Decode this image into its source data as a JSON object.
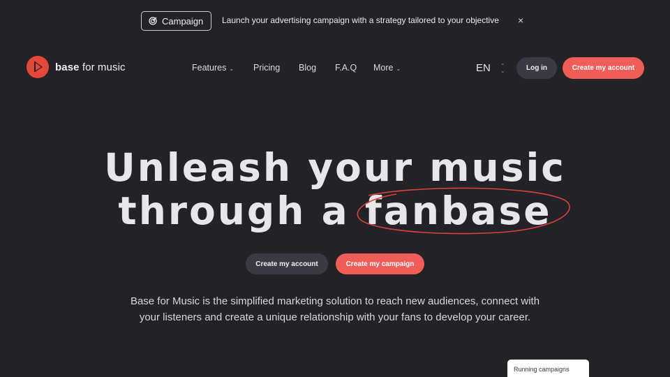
{
  "announcement": {
    "pill_label": "Campaign",
    "pill_icon": "target-icon",
    "text": "Launch your advertising campaign with a strategy tailored to your objective",
    "close_glyph": "×"
  },
  "brand": {
    "name_bold": "base",
    "name_rest": " for music",
    "accent_color": "#ef5d58"
  },
  "nav": {
    "features": "Features",
    "pricing": "Pricing",
    "blog": "Blog",
    "faq": "F.A.Q",
    "more": "More",
    "chevron_glyph": "⌄"
  },
  "language": {
    "value": "EN"
  },
  "header_buttons": {
    "login": "Log in",
    "create_account": "Create my account"
  },
  "hero": {
    "line1": "Unleash your music",
    "line2": "through a fanbase",
    "cta_account": "Create my account",
    "cta_campaign": "Create my campaign",
    "description": "Base for Music is the simplified marketing solution to reach new audiences, connect with your listeners and create a unique relationship with your fans to develop your career."
  },
  "card": {
    "label": "Running campaigns"
  }
}
